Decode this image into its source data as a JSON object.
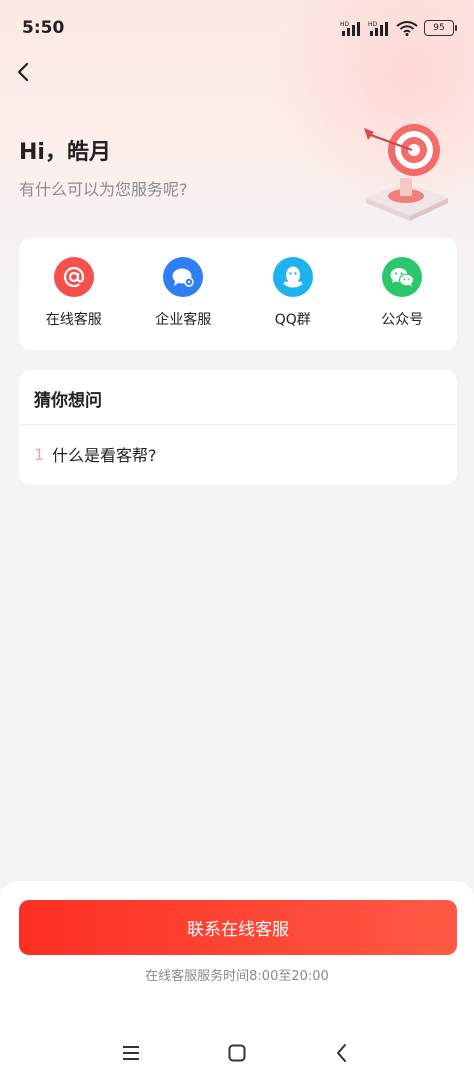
{
  "status_bar": {
    "time": "5:50",
    "signal_labels": [
      "HD",
      "HD"
    ],
    "battery": "95"
  },
  "header": {
    "greeting": "Hi，皓月",
    "subtitle": "有什么可以为您服务呢?"
  },
  "services": [
    {
      "label": "在线客服",
      "icon": "at-icon",
      "color": "#f4514d"
    },
    {
      "label": "企业客服",
      "icon": "enterprise-chat-icon",
      "color": "#2f7ef3"
    },
    {
      "label": "QQ群",
      "icon": "qq-icon",
      "color": "#1fb2f0"
    },
    {
      "label": "公众号",
      "icon": "wechat-icon",
      "color": "#2dc76b"
    }
  ],
  "guess": {
    "title": "猜你想问",
    "items": [
      {
        "num": "1",
        "text": "什么是看客帮?"
      }
    ]
  },
  "bottom": {
    "contact_label": "联系在线客服",
    "hours": "在线客服服务时间8:00至20:00"
  },
  "colors": {
    "accent": "#fd2f23",
    "background": "#f4f4f4"
  }
}
